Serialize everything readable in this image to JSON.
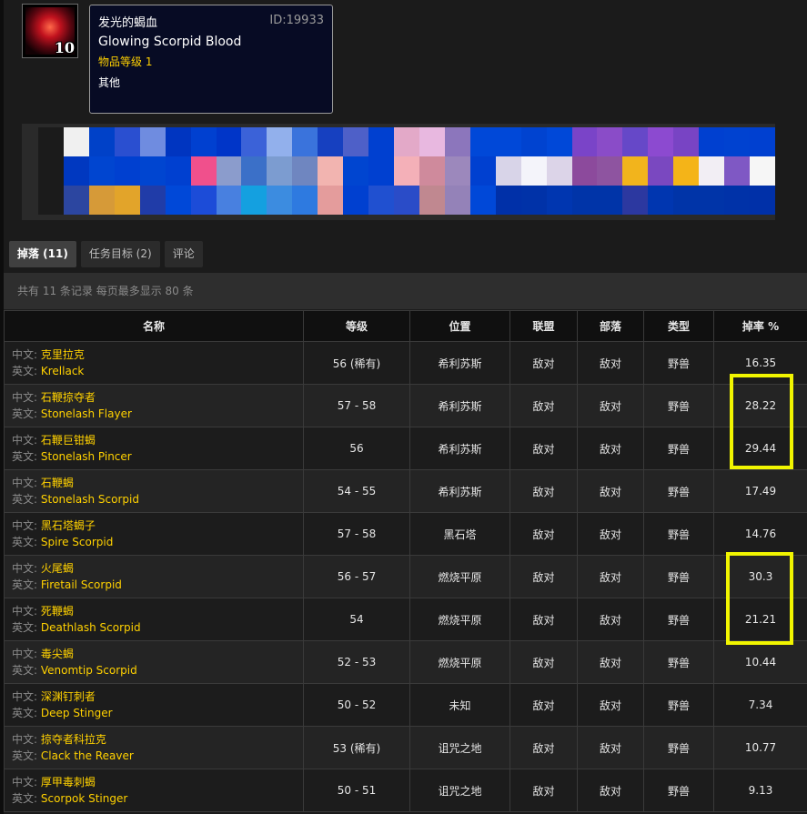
{
  "item": {
    "icon": "scorpid-blood-icon",
    "stack_count": "10",
    "name_cn": "发光的蝎血",
    "id_label": "ID:19933",
    "name_en": "Glowing Scorpid Blood",
    "item_level": "物品等级 1",
    "category": "其他"
  },
  "mosaic_colors": [
    [
      "#1b1b1b",
      "#f0f0f0",
      "#0041c8",
      "#2a4fd0",
      "#6f8ce0",
      "#0035c0",
      "#0040d0",
      "#0035c8",
      "#3b62d8",
      "#92b0ec",
      "#3a73dc",
      "#1640c0",
      "#4e60c8",
      "#0040d0",
      "#e3a9c8",
      "#e8b8e0",
      "#8c76bc",
      "#0048d8",
      "#0048d8",
      "#0043d0",
      "#0048d8",
      "#7a44c8",
      "#8a4cc8",
      "#6648c8",
      "#8c4ad0",
      "#7844c4",
      "#0040d0",
      "#0042d0",
      "#0040d0"
    ],
    [
      "#1b1b1b",
      "#0038c0",
      "#0045d0",
      "#0040d0",
      "#0045d0",
      "#0040d0",
      "#f0508c",
      "#8b9ccc",
      "#3b70c8",
      "#7c9cd0",
      "#6f86c0",
      "#f2b4b0",
      "#0045d0",
      "#0040d0",
      "#f4b0b8",
      "#cf8a9c",
      "#9c88bc",
      "#0040d0",
      "#d8d4e8",
      "#f4f4fa",
      "#dcd4e8",
      "#8c4a9c",
      "#8e54a0",
      "#f2b41c",
      "#7a48c0",
      "#f4b418",
      "#f2eef4",
      "#7f58c4",
      "#f6f6f6"
    ],
    [
      "#1b1b1b",
      "#2c46a0",
      "#d69a38",
      "#e2a42a",
      "#203ca8",
      "#0048d8",
      "#1c4cd8",
      "#4880e0",
      "#14a0e0",
      "#3c8ce0",
      "#2e7ae0",
      "#e49c9c",
      "#0040d0",
      "#2050d0",
      "#2a4cc8",
      "#c08890",
      "#9482b8",
      "#0048d8",
      "#0030a8",
      "#0032a8",
      "#0036b0",
      "#0034a8",
      "#0034a8",
      "#2c38a0",
      "#0036b0",
      "#0034a8",
      "#0034a8",
      "#0032a8",
      "#0030a8"
    ]
  ],
  "tabs": [
    {
      "label": "掉落 (11)",
      "active": true
    },
    {
      "label": "任务目标 (2)",
      "active": false
    },
    {
      "label": "评论",
      "active": false
    }
  ],
  "info_text": "共有 11 条记录 每页最多显示 80 条",
  "table": {
    "headers": [
      "名称",
      "等级",
      "位置",
      "联盟",
      "部落",
      "类型",
      "掉率 %"
    ],
    "lang_cn": "中文:",
    "lang_en": "英文:",
    "rows": [
      {
        "cn": "克里拉克",
        "en": "Krellack",
        "level": "56 (稀有)",
        "location": "希利苏斯",
        "alliance": "敌对",
        "horde": "敌对",
        "type": "野兽",
        "rate": "16.35"
      },
      {
        "cn": "石鞭掠夺者",
        "en": "Stonelash Flayer",
        "level": "57 - 58",
        "location": "希利苏斯",
        "alliance": "敌对",
        "horde": "敌对",
        "type": "野兽",
        "rate": "28.22"
      },
      {
        "cn": "石鞭巨钳蝎",
        "en": "Stonelash Pincer",
        "level": "56",
        "location": "希利苏斯",
        "alliance": "敌对",
        "horde": "敌对",
        "type": "野兽",
        "rate": "29.44"
      },
      {
        "cn": "石鞭蝎",
        "en": "Stonelash Scorpid",
        "level": "54 - 55",
        "location": "希利苏斯",
        "alliance": "敌对",
        "horde": "敌对",
        "type": "野兽",
        "rate": "17.49"
      },
      {
        "cn": "黑石塔蝎子",
        "en": "Spire Scorpid",
        "level": "57 - 58",
        "location": "黑石塔",
        "alliance": "敌对",
        "horde": "敌对",
        "type": "野兽",
        "rate": "14.76"
      },
      {
        "cn": "火尾蝎",
        "en": "Firetail Scorpid",
        "level": "56 - 57",
        "location": "燃烧平原",
        "alliance": "敌对",
        "horde": "敌对",
        "type": "野兽",
        "rate": "30.3"
      },
      {
        "cn": "死鞭蝎",
        "en": "Deathlash Scorpid",
        "level": "54",
        "location": "燃烧平原",
        "alliance": "敌对",
        "horde": "敌对",
        "type": "野兽",
        "rate": "21.21"
      },
      {
        "cn": "毒尖蝎",
        "en": "Venomtip Scorpid",
        "level": "52 - 53",
        "location": "燃烧平原",
        "alliance": "敌对",
        "horde": "敌对",
        "type": "野兽",
        "rate": "10.44"
      },
      {
        "cn": "深渊钉刺者",
        "en": "Deep Stinger",
        "level": "50 - 52",
        "location": "未知",
        "alliance": "敌对",
        "horde": "敌对",
        "type": "野兽",
        "rate": "7.34"
      },
      {
        "cn": "掠夺者科拉克",
        "en": "Clack the Reaver",
        "level": "53 (稀有)",
        "location": "诅咒之地",
        "alliance": "敌对",
        "horde": "敌对",
        "type": "野兽",
        "rate": "10.77"
      },
      {
        "cn": "厚甲毒刺蝎",
        "en": "Scorpok Stinger",
        "level": "50 - 51",
        "location": "诅咒之地",
        "alliance": "敌对",
        "horde": "敌对",
        "type": "野兽",
        "rate": "9.13"
      }
    ]
  },
  "highlight_color": "#f1f500"
}
